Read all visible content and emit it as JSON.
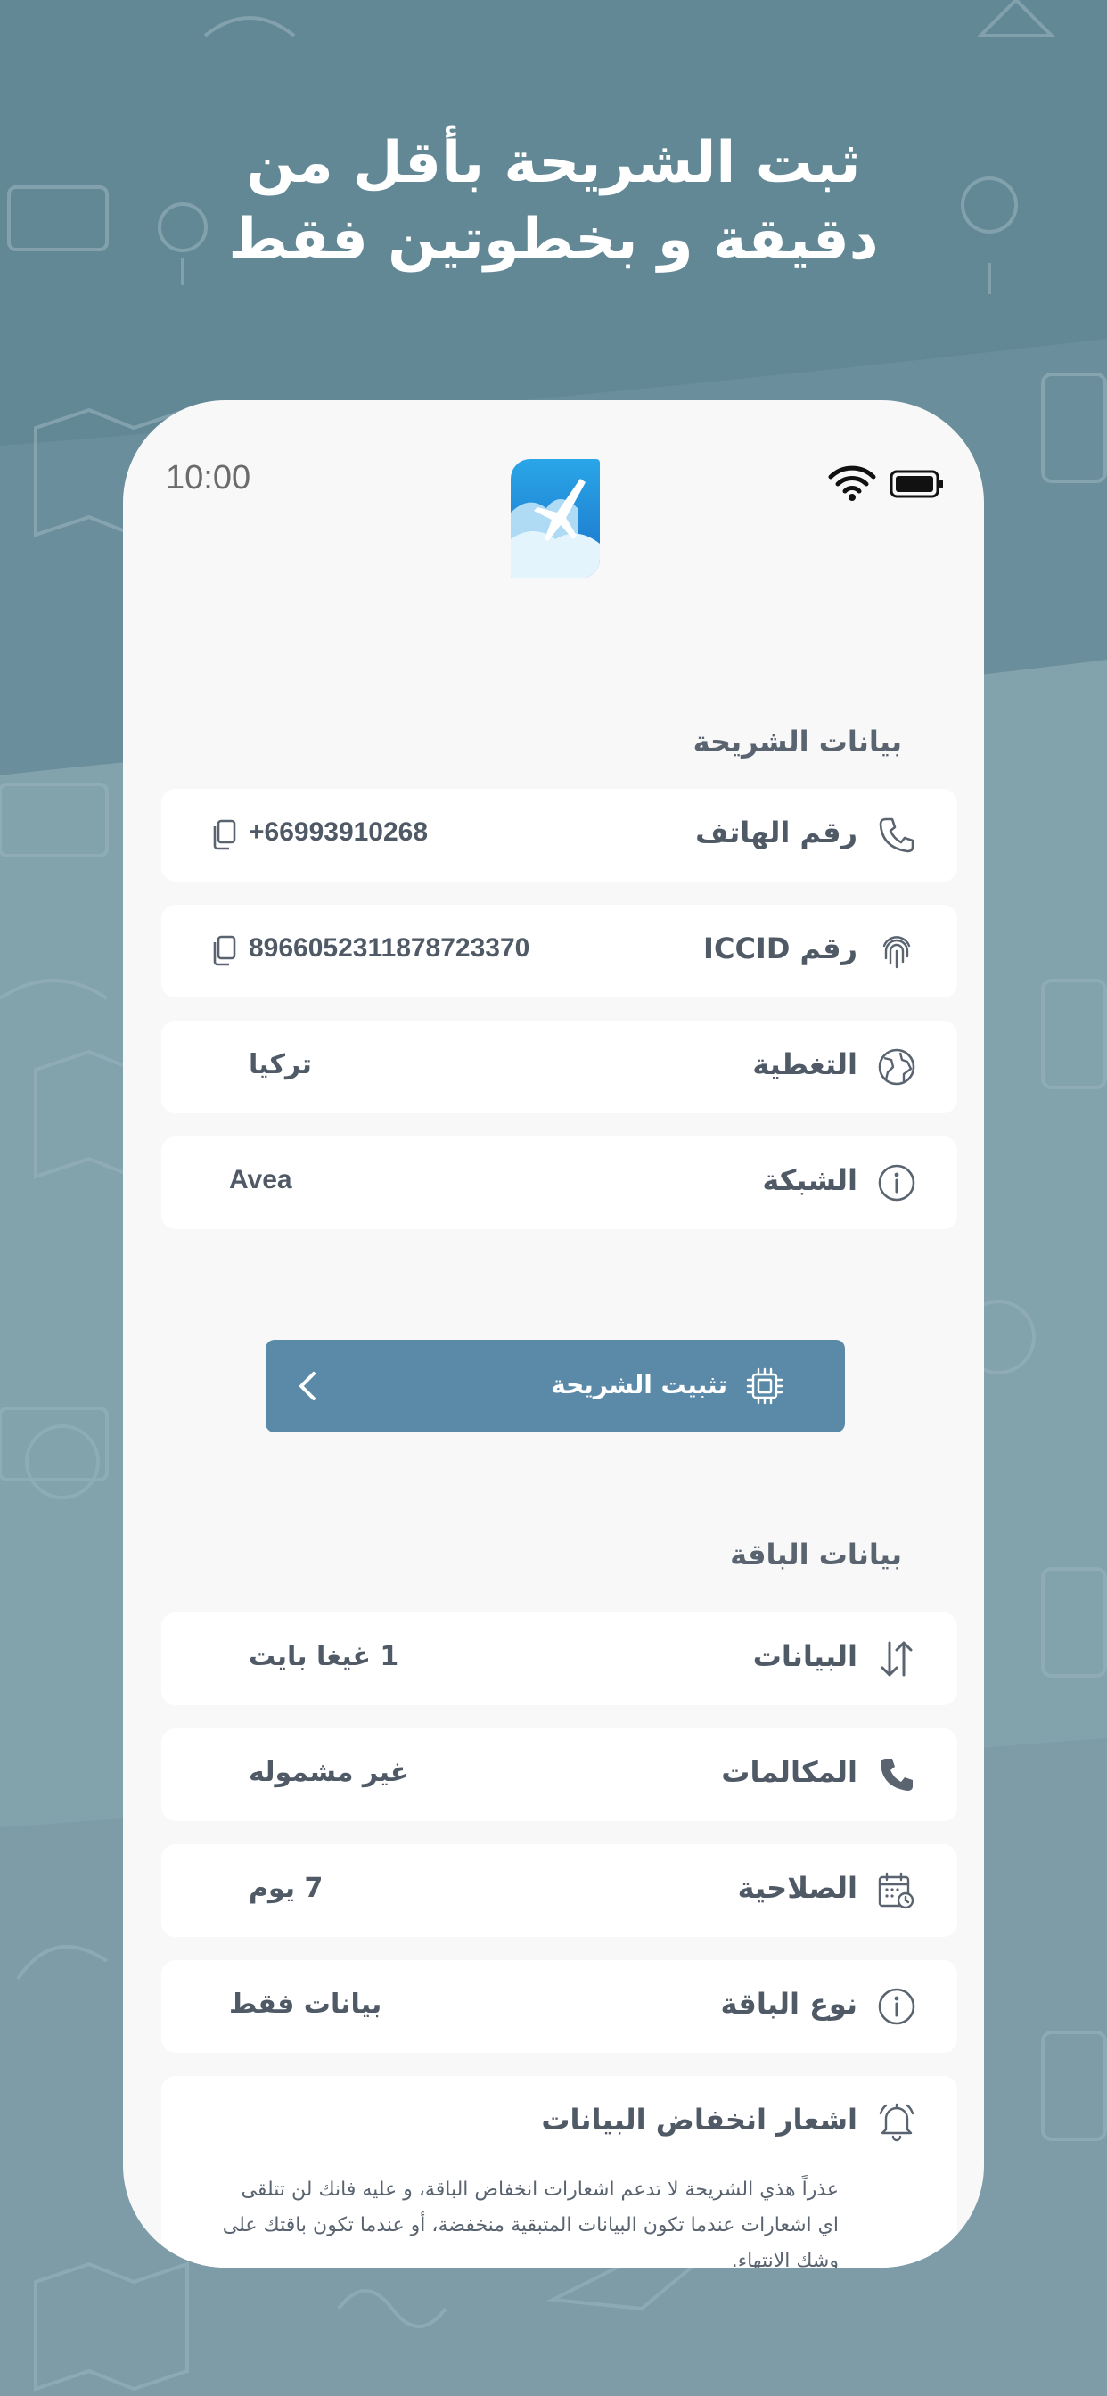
{
  "headline": {
    "line1": "ثبت الشريحة بأقل من",
    "line2": "دقيقة و بخطوتين فقط"
  },
  "status_bar": {
    "time": "10:00"
  },
  "sim_section": {
    "title": "بيانات الشريحة",
    "rows": [
      {
        "label": "رقم الهاتف",
        "value": "+66993910268",
        "icon": "phone-icon",
        "copyable": true
      },
      {
        "label": "رقم ICCID",
        "value": "8966052311878723370",
        "icon": "fingerprint-icon",
        "copyable": true
      },
      {
        "label": "التغطية",
        "value": "تركيا",
        "icon": "globe-icon",
        "copyable": false
      },
      {
        "label": "الشبكة",
        "value": "Avea",
        "icon": "info-icon",
        "copyable": false
      }
    ]
  },
  "install_button": {
    "label": "تثبيت الشريحة",
    "icon": "chip-icon"
  },
  "package_section": {
    "title": "بيانات الباقة",
    "rows": [
      {
        "label": "البيانات",
        "value": "1 غيغا بايت",
        "icon": "data-transfer-icon"
      },
      {
        "label": "المكالمات",
        "value": "غير مشموله",
        "icon": "phone-call-icon"
      },
      {
        "label": "الصلاحية",
        "value": "7 يوم",
        "icon": "calendar-clock-icon"
      },
      {
        "label": "نوع الباقة",
        "value": "بيانات فقط",
        "icon": "info-icon"
      }
    ]
  },
  "low_data_alert": {
    "title": "اشعار انخفاض البيانات",
    "icon": "bell-icon",
    "description": "عذراً هذي الشريحة لا تدعم اشعارات انخفاض الباقة، و عليه فانك لن تتلقى اي اشعارات عندما تكون البيانات المتبقية منخفضة، أو عندما تكون باقتك على وشك الانتهاء."
  },
  "colors": {
    "background": "#82a2ac",
    "background_dark": "#5f8392",
    "card": "#ffffff",
    "phone_screen": "#f8f8f8",
    "button": "#5a8aa8",
    "text": "#4f5a66"
  }
}
